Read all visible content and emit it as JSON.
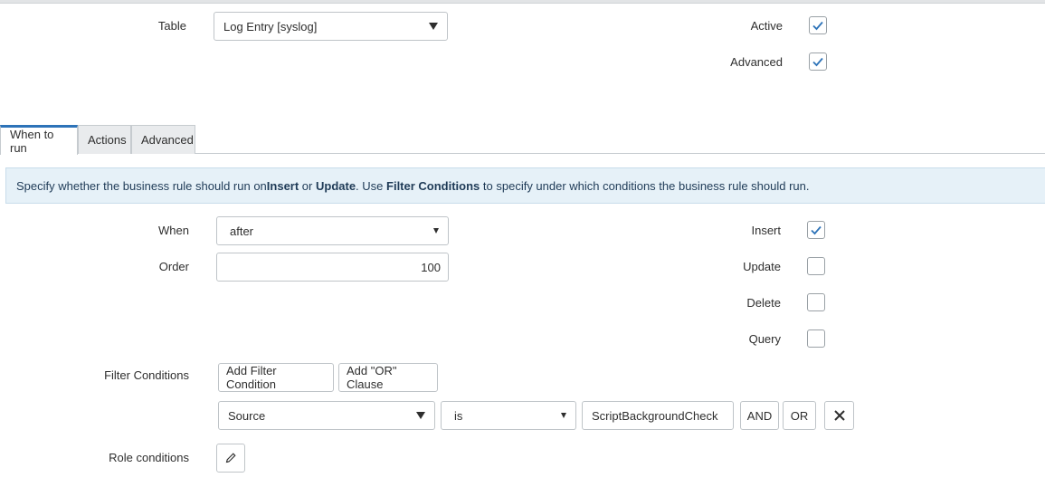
{
  "header": {
    "table_label": "Table",
    "table_value": "Log Entry [syslog]",
    "active_label": "Active",
    "active_checked": true,
    "advanced_label": "Advanced",
    "advanced_checked": true
  },
  "tabs": [
    {
      "label": "When to run",
      "active": true
    },
    {
      "label": "Actions",
      "active": false
    },
    {
      "label": "Advanced",
      "active": false
    }
  ],
  "info": {
    "part1": "Specify whether the business rule should run on ",
    "insert": "Insert",
    "or": " or ",
    "update": "Update",
    "part2": ". Use ",
    "filter_conditions": "Filter Conditions",
    "part3": " to specify under which conditions the business rule should run."
  },
  "form": {
    "when_label": "When",
    "when_value": "after",
    "order_label": "Order",
    "order_value": "100",
    "insert_label": "Insert",
    "insert_checked": true,
    "update_label": "Update",
    "update_checked": false,
    "delete_label": "Delete",
    "delete_checked": false,
    "query_label": "Query",
    "query_checked": false,
    "filter_conditions_label": "Filter Conditions",
    "add_filter_condition": "Add Filter Condition",
    "add_or_clause": "Add \"OR\" Clause",
    "condition": {
      "field": "Source",
      "operator": "is",
      "value": "ScriptBackgroundCheck",
      "and_label": "AND",
      "or_label": "OR"
    },
    "role_conditions_label": "Role conditions"
  },
  "colors": {
    "accent": "#2d73b8",
    "info_bg": "#e6f1f8",
    "border": "#bfc4c8"
  },
  "icons": {
    "dropdown": "triangle-down-icon",
    "check": "check-icon",
    "remove": "x-icon",
    "edit": "pencil-icon"
  }
}
